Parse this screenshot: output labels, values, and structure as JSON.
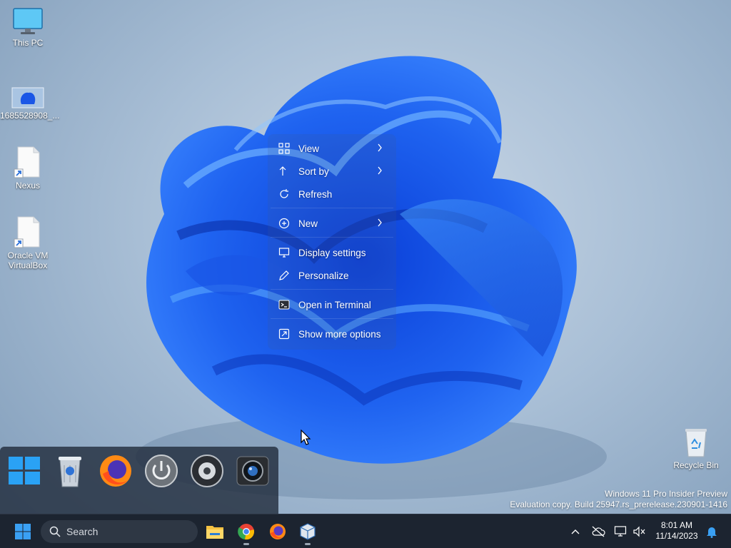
{
  "desktop": {
    "icons": [
      {
        "label": "This PC",
        "icon": "monitor-icon"
      },
      {
        "label": "1685528908_...",
        "icon": "image-file-icon"
      },
      {
        "label": "Nexus",
        "icon": "shortcut-file-icon"
      },
      {
        "label": "Oracle VM VirtualBox",
        "icon": "shortcut-file-icon"
      },
      {
        "label": "Recycle Bin",
        "icon": "recycle-bin-icon"
      }
    ]
  },
  "context_menu": {
    "items": [
      {
        "label": "View",
        "icon": "grid-icon",
        "submenu": true
      },
      {
        "label": "Sort by",
        "icon": "sort-icon",
        "submenu": true
      },
      {
        "label": "Refresh",
        "icon": "refresh-icon",
        "submenu": false
      },
      {
        "label": "New",
        "icon": "plus-circle-icon",
        "submenu": true
      },
      {
        "label": "Display settings",
        "icon": "display-icon",
        "submenu": false
      },
      {
        "label": "Personalize",
        "icon": "pen-icon",
        "submenu": false
      },
      {
        "label": "Open in Terminal",
        "icon": "terminal-icon",
        "submenu": false
      },
      {
        "label": "Show more options",
        "icon": "more-options-icon",
        "submenu": false
      }
    ]
  },
  "dock": {
    "items": [
      "windows-logo-icon",
      "trash-can-icon",
      "firefox-icon",
      "power-icon",
      "speaker-icon",
      "camera-icon"
    ]
  },
  "watermark": {
    "line1": "Windows 11 Pro Insider Preview",
    "line2": "Evaluation copy. Build 25947.rs_prerelease.230901-1416"
  },
  "taskbar": {
    "search_label": "Search",
    "apps": [
      "file-explorer-icon",
      "chrome-icon",
      "firefox-icon",
      "virtualbox-icon"
    ],
    "tray": [
      "chevron-up-icon",
      "cloud-off-icon",
      "network-icon",
      "volume-muted-icon"
    ],
    "time": "8:01 AM",
    "date": "11/14/2023"
  },
  "colors": {
    "accent": "#2f7bff",
    "taskbar": "#1c2430"
  }
}
